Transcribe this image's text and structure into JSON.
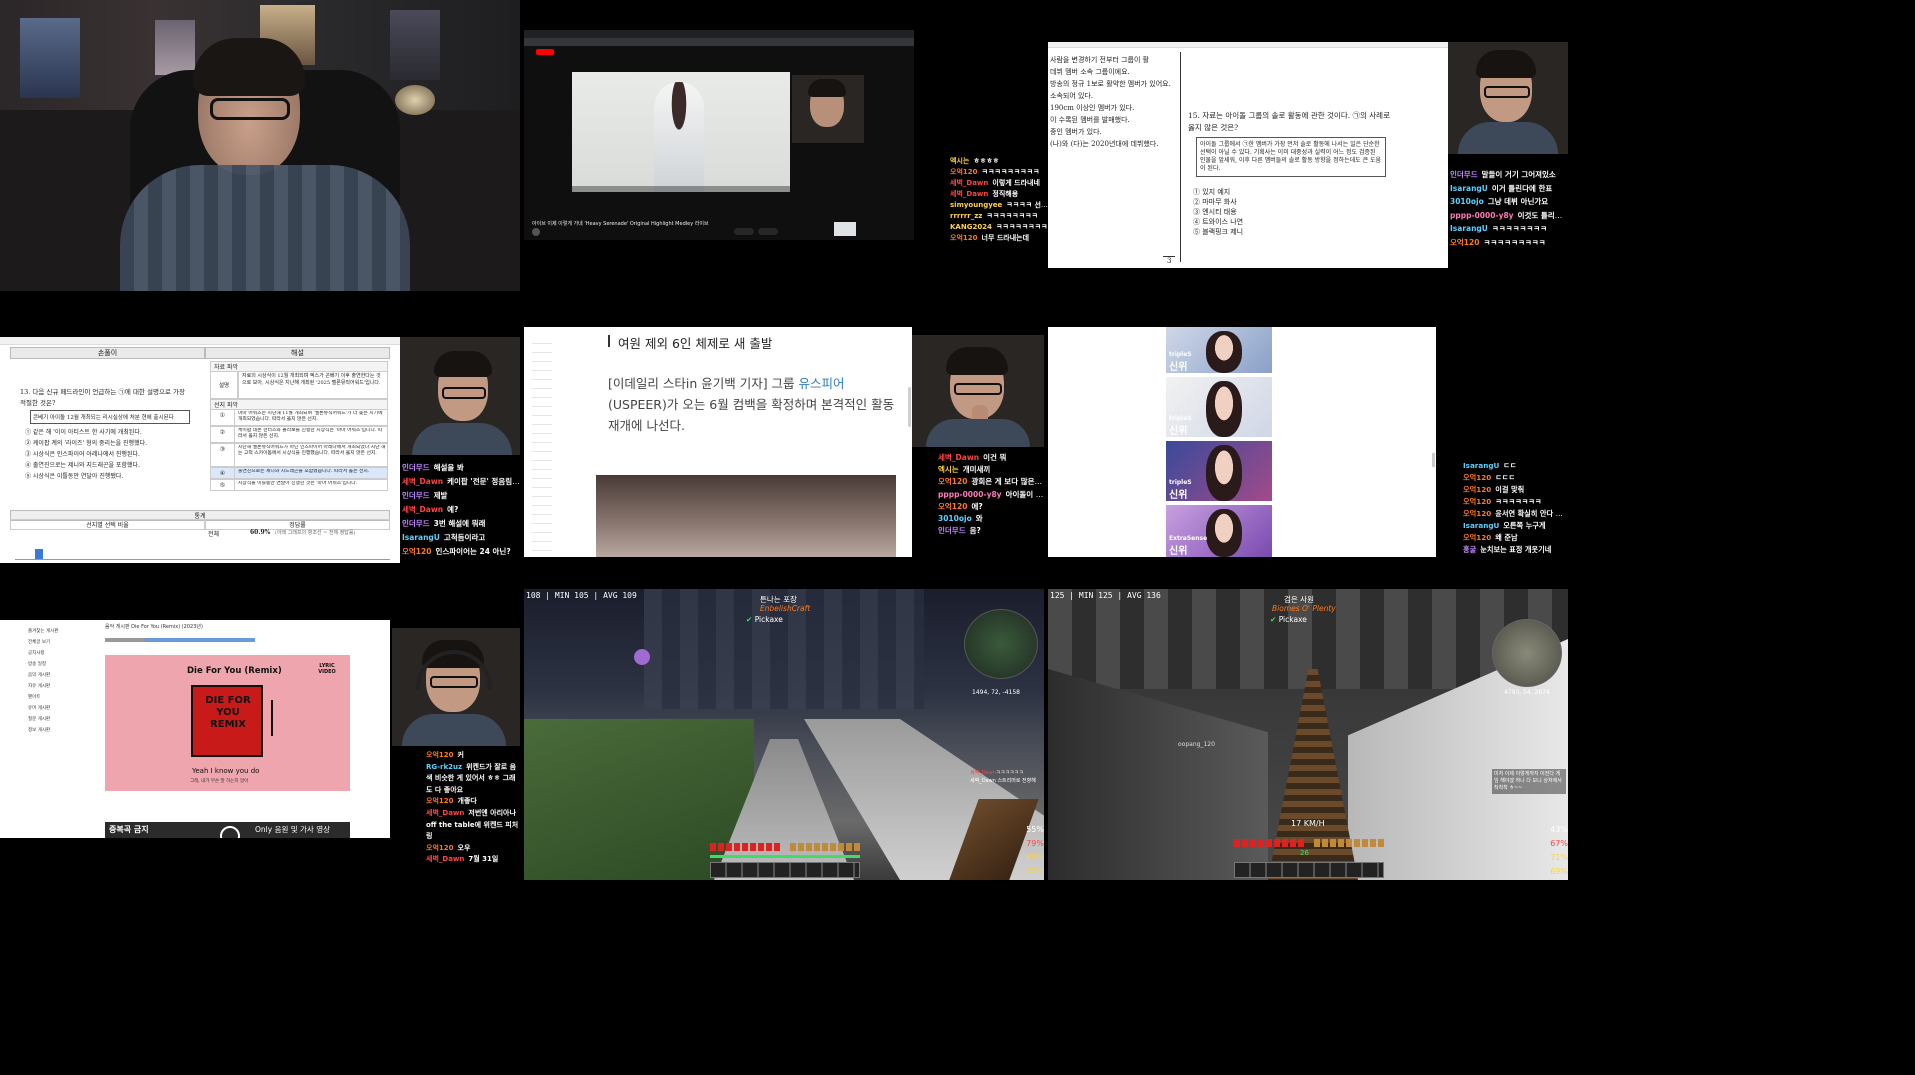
{
  "colors": {
    "orange": "#ff7a1a",
    "red": "#ff4444",
    "yellow": "#ffd23f",
    "blue": "#4a9bff",
    "green": "#3fdc6a",
    "purple": "#c08aff",
    "cyan": "#5ad1ff",
    "pink": "#ff7ab8"
  },
  "tile_yt": {
    "video_title": "아이브 이제 이렇게 가네 'Heavy Serenade' Original Highlight Medley 라이브",
    "chat": [
      {
        "user": "엑시는",
        "msg": "ㅎㅎㅎㅎ",
        "color": "#ffd23f"
      },
      {
        "user": "오억120",
        "msg": "ㅋㅋㅋㅋㅋㅋㅋㅋㅋ",
        "color": "#ff7a1a"
      },
      {
        "user": "세벽_Dawn",
        "msg": "이렇게 드라내네",
        "color": "#ff4444"
      },
      {
        "user": "세벽_Dawn",
        "msg": "정직해용",
        "color": "#ff4444"
      },
      {
        "user": "simyoungyee",
        "msg": "ㅋㅋㅋㅋ 선거불관",
        "color": "#ffd23f"
      },
      {
        "user": "rrrrrr_zz",
        "msg": "ㅋㅋㅋㅋㅋㅋㅋㅋ",
        "color": "#ffd23f"
      },
      {
        "user": "KANG2024",
        "msg": "ㅋㅋㅋㅋㅋㅋㅋㅋ",
        "color": "#ffd23f"
      },
      {
        "user": "오억120",
        "msg": "너무 드라내는데",
        "color": "#ff7a1a"
      }
    ]
  },
  "tile_exam15": {
    "question": "15. 자료는 아이돌 그룹의 솔로 활동에 관한 것이다. ㉠의 사례로 옳지 않은 것은?",
    "box_text": "아이돌 그룹에서 ㉠한 멤버가 가장 먼저 솔로 활동에 나서는 일은 단순한 선택이 아닐 수 있다. 기획사는 이미 대중성과 실력이 어느 정도 검증된 인물을 앞세워, 이후 다른 멤버들의 솔로 활동 방향을 정하는데도 큰 도움이 된다.",
    "options": [
      "① 있지 예지",
      "② 마마무 화사",
      "③ 엔시티 태용",
      "④ 트와이스 나연",
      "⑤ 블랙핑크 제니"
    ],
    "left_lines": [
      "사람을 변경하기 전부터 그룹이 활",
      "데뷔 멤버 소속 그룹이에요.",
      "방송의 정규 1보로 활약한 멤버가 있어요.",
      "소속되어 있다.",
      "190cm 이상인 멤버가 있다.",
      "이 수록된 멤버를 발매했다.",
      "중인 멤버가 있다.",
      "(나)와 (다)는 2020년대에 데뷔했다."
    ],
    "page": "3",
    "chat": [
      {
        "user": "인더무드",
        "msg": "말들이 거기 그어져있소",
        "color": "#c08aff"
      },
      {
        "user": "IsarangU",
        "msg": "이거 틀린다에 한표",
        "color": "#5ad1ff"
      },
      {
        "user": "3010ojo",
        "msg": "그냥 데뷔 아닌가요",
        "color": "#5ad1ff"
      },
      {
        "user": "pppp-0000-y8y",
        "msg": "이것도 틀리겠다 ㅋㅋㅋㅋ",
        "color": "#ff7ab8"
      },
      {
        "user": "IsarangU",
        "msg": "ㅋㅋㅋㅋㅋㅋㅋㅋ",
        "color": "#5ad1ff"
      },
      {
        "user": "오억120",
        "msg": "ㅋㅋㅋㅋㅋㅋㅋㅋㅋ",
        "color": "#ff7a1a"
      }
    ]
  },
  "tile_exam13": {
    "col_left": "손풀이",
    "col_right": "해설",
    "question": "13. 다음 신규 페드라인이 언급하는 ㉠에 대한 설명으로 가장 적절한 것은?",
    "box_text": "콘베기 아이돌 12월 개최되는 리시실상에 처분 현에 출시된다",
    "options": [
      "① 같은 해 '이이 아티스트 한 사기에 개최된다.",
      "② 케이팝 계의 '라이즈' 형의 중리는을 진행했다.",
      "③ 시상식은 인스파이어 아레나에서 진행된다.",
      "④ 출연진으로는 제니와 지드래곤을 포함했다.",
      "⑤ 시상식은 이틀동안 연달아 진행됐다."
    ],
    "data_header": "자료 파악",
    "data_label": "설명",
    "data_text": "자료의 시상식이 12월 개최되며 엑스가 곤베기 이후 출연한다는 것으로 보아, 시상식은 지난해 개최된 '2025 멜론뮤직어워드'입니다.",
    "choice_header": "선지 파악",
    "choices": [
      {
        "num": "①",
        "text": "마마 어워즈는 지난해 11월 개최되며 '멜론뮤직어워드'가 더 늦은 시기에 개최되었습니다. 따라서 옳지 않은 선지."
      },
      {
        "num": "②",
        "text": "케이팝 데몬 헌터스와 콜라보를 진행한 시상식은 '마마 어워즈'입니다. 따라서 옳지 않은 선지."
      },
      {
        "num": "③",
        "text": "지난해 멜론뮤직어워드가 아닌 인스파이어 아레나에서 개최되었나 지난 해는 고척 스카이돔에서 시상식을 진행했습니다. 따라서 옳지 않은 선지."
      },
      {
        "num": "④",
        "text": "출연진으로는 제니와 지드래곤을 포함했습니다. 따라서 옳은 선지."
      },
      {
        "num": "⑤",
        "text": "시상식을 이틀동안 연달아 진행한 것은 '마마 어워즈'입니다."
      }
    ],
    "stats_header": "통계",
    "stats_left": "선지별 선택 비율",
    "stats_right": "정답률",
    "stats_total_label": "전체",
    "stats_total_value": "60.9%",
    "stats_note": "(아래 그래프의 항조선 = 전체 정답률)",
    "chat": [
      {
        "user": "인더무드",
        "msg": "해설을 봐",
        "color": "#c08aff"
      },
      {
        "user": "세벽_Dawn",
        "msg": "케이팝 '전문' 정음림 맞죠",
        "color": "#ff4444"
      },
      {
        "user": "인더무드",
        "msg": "제발",
        "color": "#c08aff"
      },
      {
        "user": "세벽_Dawn",
        "msg": "예?",
        "color": "#ff4444"
      },
      {
        "user": "인더무드",
        "msg": "3번 해설에 뭐래",
        "color": "#c08aff"
      },
      {
        "user": "IsarangU",
        "msg": "고척돔이라고",
        "color": "#5ad1ff"
      },
      {
        "user": "오억120",
        "msg": "인스파이어는 24 아닌?",
        "color": "#ff7a1a"
      }
    ]
  },
  "tile_news": {
    "headline": "여원 제외 6인 체제로 새 출발",
    "body_prefix": "[이데일리 스타in 윤기백 기자] 그룹 ",
    "body_link": "유스피어",
    "body_rest": "(USPEER)가 오는 6월 컴백을 확정하며 본격적인 활동 재개에 나선다.",
    "chat": [
      {
        "user": "세벽_Dawn",
        "msg": "이건 뭐",
        "color": "#ff4444"
      },
      {
        "user": "엑시는",
        "msg": "개미새끼",
        "color": "#ffd23f"
      },
      {
        "user": "오억120",
        "msg": "광희은 게 보다 많은거 아님?",
        "color": "#ff7a1a"
      },
      {
        "user": "pppp-0000-y8y",
        "msg": "아이돌이 수능 한국사 감성해주대대",
        "color": "#ff7ab8"
      },
      {
        "user": "오억120",
        "msg": "에?",
        "color": "#ff7a1a"
      },
      {
        "user": "3010ojo",
        "msg": "와",
        "color": "#5ad1ff"
      },
      {
        "user": "인더무드",
        "msg": "음?",
        "color": "#c08aff"
      }
    ]
  },
  "tile_photos": {
    "cards": [
      {
        "brand": "tripleS",
        "name": "신위"
      },
      {
        "brand": "tripleS",
        "name": "신위"
      },
      {
        "brand": "tripleS",
        "name": "신위"
      },
      {
        "brand": "ExtraSense",
        "name": "신위"
      }
    ],
    "chat": [
      {
        "user": "IsarangU",
        "msg": "ㄷㄷ",
        "color": "#5ad1ff"
      },
      {
        "user": "오억120",
        "msg": "ㄷㄷㄷ",
        "color": "#ff7a1a"
      },
      {
        "user": "오억120",
        "msg": "이걸 맞춰",
        "color": "#ff7a1a"
      },
      {
        "user": "오억120",
        "msg": "ㅋㅋㅋㅋㅋㅋㅋ",
        "color": "#ff7a1a"
      },
      {
        "user": "오억120",
        "msg": "윤서연 확실히 안다 이제",
        "color": "#ff7a1a"
      },
      {
        "user": "IsarangU",
        "msg": "오른쪽 누구게",
        "color": "#5ad1ff"
      },
      {
        "user": "오억120",
        "msg": "왜 준남",
        "color": "#ff7a1a"
      },
      {
        "user": "홍굴",
        "msg": "눈치보는 표정 개웃기네",
        "color": "#c08aff"
      }
    ]
  },
  "tile_music": {
    "post_title": "음악 게시판 Die For You (Remix) (2023년)",
    "song_title": "Die For You (Remix)",
    "lyric_badge": "LYRIC VIDEO",
    "album_text": "DIE FOR YOU REMIX",
    "lyric_main": "Yeah I know you do",
    "lyric_sub": "그래, 내가 무슨 말 하는지 알아",
    "banner_left": "중복곡 금지",
    "banner_right": "Only 음원 및 가사 영상",
    "sidebar_items": [
      "즐겨찾는 게시판",
      "전체글 보기",
      "공지사항",
      "방송 일정",
      "음악 게시판",
      "자유 게시판",
      "팬아트",
      "유머 게시판",
      "질문 게시판",
      "정보 게시판"
    ],
    "chat": [
      {
        "user": "오억120",
        "msg": "커",
        "color": "#ff7a1a"
      },
      {
        "user": "RG-rk2uz",
        "msg": "위켄드가 잘로 음색 비슷한 게 있어서 ㅎㅎ 그래도 다 좋아요",
        "color": "#5ad1ff"
      },
      {
        "user": "오억120",
        "msg": "개좋다",
        "color": "#ff7a1a"
      },
      {
        "user": "세벽_Dawn",
        "msg": "저번엔 아리아나 off the table에 위켄드 피처링",
        "color": "#ff4444"
      },
      {
        "user": "오억120",
        "msg": "오우",
        "color": "#ff7a1a"
      },
      {
        "user": "세벽_Dawn",
        "msg": "7월 31일",
        "color": "#ff4444"
      }
    ]
  },
  "tile_mc1": {
    "stats": "108 | MIN 105 | AVG 109",
    "location": "튼나는 포장",
    "sublocation": "EnbelishCraft",
    "item": "Pickaxe",
    "coords": "1494, 72, -4158",
    "hud": [
      "55%",
      "79%",
      "85%",
      "82%"
    ],
    "chat": [
      {
        "user": "세벽_Dawn",
        "msg": "ㅋㅋㅋㅋㅋㅋ",
        "color": "#ff4444"
      },
      {
        "user": "",
        "msg": "세벽_Dawn 스트리머로 전향해",
        "color": "#ffffff"
      }
    ]
  },
  "tile_mc2": {
    "stats": "125 | MIN 125 | AVG 136",
    "location": "검은 사원",
    "sublocation": "Biomes O' Plenty",
    "item": "Pickaxe",
    "speed": "17 KM/H",
    "player": "oopang_120",
    "coords": "4793, 54, 2674",
    "level": "26",
    "hud": [
      "43%",
      "67%",
      "71%",
      "69%"
    ],
    "chat_note": "미처 이제 이렇게까지 이전다 게임 해야겠 하니 다 보니 상처에서 착착착 ㅎ~~"
  }
}
